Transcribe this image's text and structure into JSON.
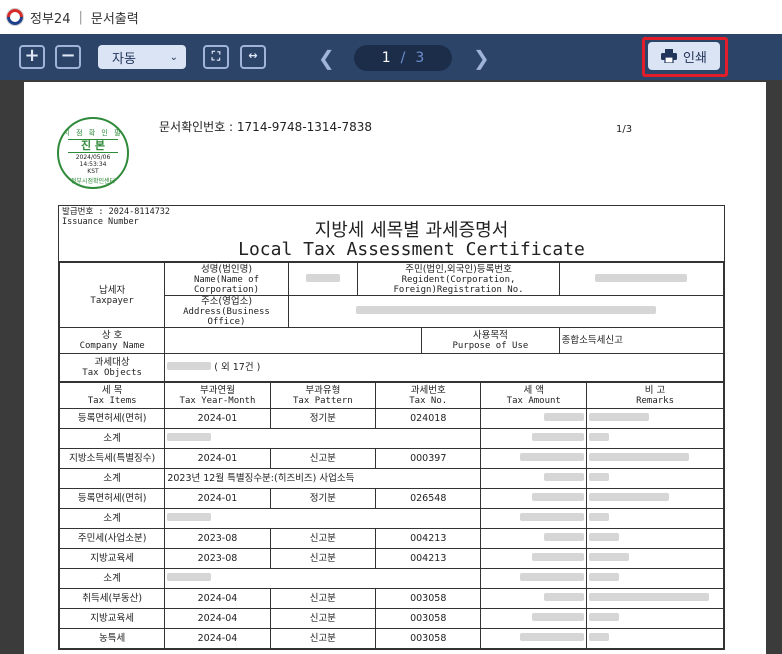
{
  "window": {
    "app_name": "정부24",
    "title": "문서출력"
  },
  "toolbar": {
    "zoom_value": "자동",
    "page_current": "1",
    "page_total": "3",
    "print_label": "인쇄"
  },
  "document": {
    "seal": {
      "line1": "시 점 확 인 필",
      "main": "진 본",
      "date": "2024/05/06",
      "time": "14:53:34",
      "zone": "KST",
      "org": "정부시점확인센터"
    },
    "doc_number": "문서확인번호 : 1714-9748-1314-7838",
    "page_indicator": "1/3",
    "issue_line1": "발급번호 : 2024-8114732",
    "issue_line2": "Issuance Number",
    "title_ko": "지방세 세목별 과세증명서",
    "title_en": "Local Tax Assessment Certificate",
    "labels": {
      "taxpayer_ko": "납세자",
      "taxpayer_en": "Taxpayer",
      "name_ko": "성명(법인명)",
      "name_en1": "Name(Name of",
      "name_en2": "Corporation)",
      "regno_ko": "주민(법인,외국인)등록번호",
      "regno_en1": "Regident(Corporation,",
      "regno_en2": "Foreign)Registration No.",
      "address_ko": "주소(영업소)",
      "address_en": "Address(Business Office)",
      "company_ko": "상  호",
      "company_en": "Company Name",
      "purpose_ko": "사용목적",
      "purpose_en": "Purpose of Use",
      "purpose_value": "종합소득세신고",
      "objects_ko": "과세대상",
      "objects_en": "Tax Objects",
      "objects_value": "( 외 17건 )"
    },
    "columns": [
      {
        "ko": "세  목",
        "en": "Tax Items"
      },
      {
        "ko": "부과연월",
        "en": "Tax Year-Month"
      },
      {
        "ko": "부과유형",
        "en": "Tax Pattern"
      },
      {
        "ko": "과세번호",
        "en": "Tax No."
      },
      {
        "ko": "세  액",
        "en": "Tax Amount"
      },
      {
        "ko": "비  고",
        "en": "Remarks"
      }
    ],
    "rows": [
      {
        "item": "등록면허세(면허)",
        "ym": "2024-01",
        "pattern": "정기분",
        "no": "024018"
      },
      {
        "item": "소계",
        "note": ""
      },
      {
        "item": "지방소득세(특별징수)",
        "ym": "2024-01",
        "pattern": "신고분",
        "no": "000397"
      },
      {
        "item": "소계",
        "note": "2023년 12월 특별징수분:(히즈비즈) 사업소득"
      },
      {
        "item": "등록면허세(면허)",
        "ym": "2024-01",
        "pattern": "정기분",
        "no": "026548"
      },
      {
        "item": "소계",
        "note": ""
      },
      {
        "item": "주민세(사업소분)",
        "ym": "2023-08",
        "pattern": "신고분",
        "no": "004213"
      },
      {
        "item": "지방교육세",
        "ym": "2023-08",
        "pattern": "신고분",
        "no": "004213"
      },
      {
        "item": "소계",
        "note": ""
      },
      {
        "item": "취득세(부동산)",
        "ym": "2024-04",
        "pattern": "신고분",
        "no": "003058"
      },
      {
        "item": "지방교육세",
        "ym": "2024-04",
        "pattern": "신고분",
        "no": "003058"
      },
      {
        "item": "농특세",
        "ym": "2024-04",
        "pattern": "신고분",
        "no": "003058"
      }
    ]
  }
}
